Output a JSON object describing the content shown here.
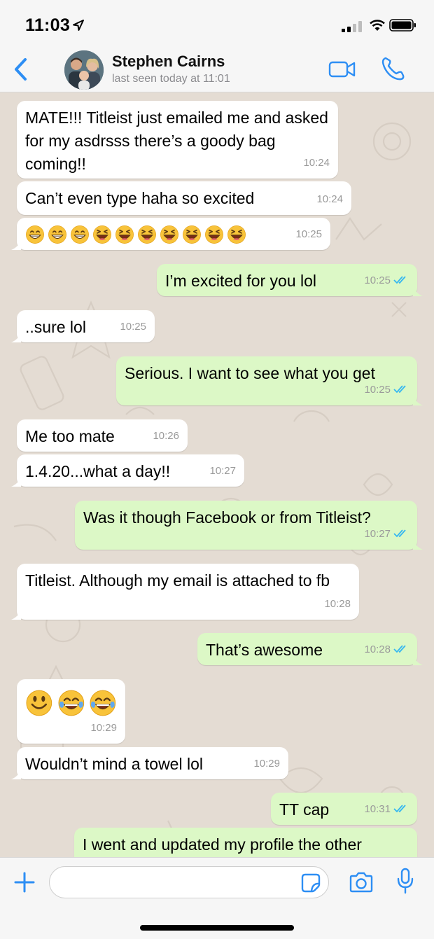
{
  "status_bar": {
    "time": "11:03"
  },
  "header": {
    "contact_name": "Stephen Cairns",
    "contact_status": "last seen today at 11:01"
  },
  "colors": {
    "accent": "#2d8ef4",
    "incoming_bubble": "#ffffff",
    "outgoing_bubble": "#dcf8c6",
    "read_ticks": "#34b7f1",
    "chat_background": "#e4dcd3"
  },
  "messages": [
    {
      "dir": "in",
      "text": "MATE!!! Titleist just emailed me and asked for my asdrsss there’s a goody bag coming!!",
      "time": "10:24"
    },
    {
      "dir": "in",
      "text": "Can’t even type haha so excited",
      "time": "10:24"
    },
    {
      "dir": "in",
      "emoji": [
        "grin-icon",
        "grin-icon",
        "grin-icon",
        "laughing-icon",
        "laughing-icon",
        "laughing-icon",
        "laughing-icon",
        "laughing-icon",
        "laughing-icon",
        "laughing-icon"
      ],
      "time": "10:25"
    },
    {
      "dir": "out",
      "text": "I’m excited for you lol",
      "time": "10:25",
      "read": true
    },
    {
      "dir": "in",
      "text": "..sure lol",
      "time": "10:25"
    },
    {
      "dir": "out",
      "text": "Serious. I want to see what you get",
      "time": "10:25",
      "read": true
    },
    {
      "dir": "in",
      "text": "Me too mate",
      "time": "10:26"
    },
    {
      "dir": "in",
      "text": "1.4.20...what a day!!",
      "time": "10:27"
    },
    {
      "dir": "out",
      "text": "Was it though Facebook or from Titleist?",
      "time": "10:27",
      "read": true
    },
    {
      "dir": "in",
      "text": "Titleist. Although my email is attached to fb",
      "time": "10:28"
    },
    {
      "dir": "out",
      "text": "That’s awesome",
      "time": "10:28",
      "read": true
    },
    {
      "dir": "in",
      "emoji": [
        "smiley-icon",
        "joy-icon",
        "joy-icon"
      ],
      "time": "10:29"
    },
    {
      "dir": "in",
      "text": "Wouldn’t mind a towel lol",
      "time": "10:29"
    },
    {
      "dir": "out",
      "text": "TT cap",
      "time": "10:31",
      "read": true
    },
    {
      "dir": "out",
      "text": "I went and updated my profile the other",
      "time": "",
      "read": false
    }
  ],
  "input": {
    "placeholder": ""
  }
}
